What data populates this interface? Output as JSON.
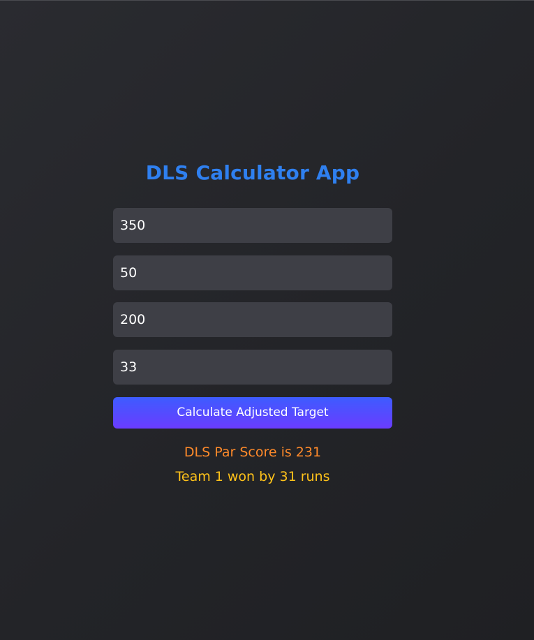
{
  "app": {
    "title": "DLS Calculator App"
  },
  "form": {
    "fields": [
      {
        "value": "350"
      },
      {
        "value": "50"
      },
      {
        "value": "200"
      },
      {
        "value": "33"
      }
    ],
    "submit_label": "Calculate Adjusted Target"
  },
  "results": {
    "par_score_text": "DLS Par Score is 231",
    "outcome_text": "Team 1 won by 31 runs"
  },
  "colors": {
    "title": "#2f80f0",
    "input_background": "#3e3f46",
    "button_gradient_start": "#3d5cff",
    "button_gradient_end": "#6a3cff",
    "par_score_text": "#ff8a2a",
    "outcome_text": "#ffc21a",
    "page_background": "#232428"
  }
}
